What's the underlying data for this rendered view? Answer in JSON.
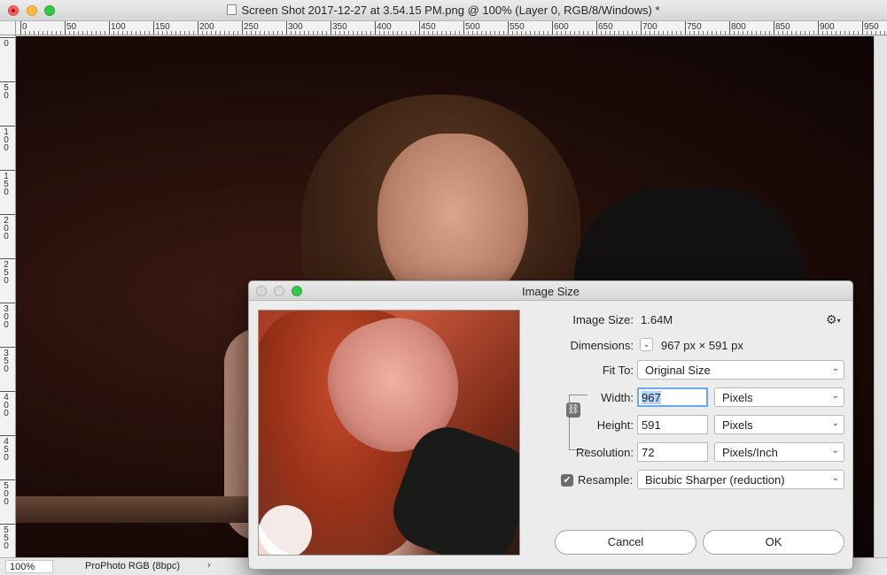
{
  "window": {
    "title": "Screen Shot 2017-12-27 at 3.54.15 PM.png @ 100% (Layer 0, RGB/8/Windows) *"
  },
  "ruler": {
    "top_labels": [
      "0",
      "50",
      "100",
      "150",
      "200",
      "250",
      "300",
      "350",
      "400",
      "450",
      "500",
      "550",
      "600",
      "650",
      "700",
      "750",
      "800",
      "850",
      "900",
      "950"
    ],
    "left_labels": [
      "0",
      "50",
      "100",
      "150",
      "200",
      "250",
      "300",
      "350",
      "400",
      "450",
      "500",
      "550"
    ]
  },
  "status": {
    "zoom": "100%",
    "profile": "ProPhoto RGB (8bpc)",
    "arrow": "›"
  },
  "dialog": {
    "title": "Image Size",
    "image_size_label": "Image Size:",
    "image_size_value": "1.64M",
    "dimensions_label": "Dimensions:",
    "dimensions_value": "967 px  ×  591 px",
    "fit_to_label": "Fit To:",
    "fit_to_value": "Original Size",
    "width_label": "Width:",
    "width_value": "967",
    "width_unit": "Pixels",
    "height_label": "Height:",
    "height_value": "591",
    "height_unit": "Pixels",
    "resolution_label": "Resolution:",
    "resolution_value": "72",
    "resolution_unit": "Pixels/Inch",
    "resample_label": "Resample:",
    "resample_checked": true,
    "resample_value": "Bicubic Sharper (reduction)",
    "cancel_label": "Cancel",
    "ok_label": "OK"
  },
  "icons": {
    "gear": "gear-icon",
    "link": "link-icon",
    "chevron": "chevron-down-icon",
    "checkmark": "checkmark-icon"
  },
  "colors": {
    "focus_ring": "#6ea6f2",
    "selection": "#b3d3fb",
    "close_light": "#fc605c",
    "minimize_light": "#fdbc40",
    "zoom_light": "#34c84a"
  }
}
